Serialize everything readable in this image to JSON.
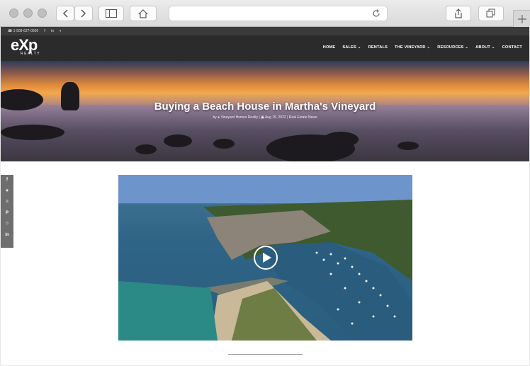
{
  "topbar": {
    "phone": "1-508-627-0506",
    "social_icons": [
      "facebook-icon",
      "linkedin-icon",
      "rss-icon"
    ],
    "social_glyphs": [
      "f",
      "in",
      "◐"
    ]
  },
  "logo": {
    "mark": "eXp",
    "tagline": "REALTY"
  },
  "nav": {
    "items": [
      {
        "label": "HOME"
      },
      {
        "label": "SALES",
        "caret": "⌄"
      },
      {
        "label": "RENTALS"
      },
      {
        "label": "THE VINEYARD",
        "caret": "⌄"
      },
      {
        "label": "RESOURCES",
        "caret": "⌄"
      },
      {
        "label": "ABOUT",
        "caret": "⌄"
      },
      {
        "label": "CONTACT"
      }
    ]
  },
  "post": {
    "title": "Buying a Beach House in Martha's Vineyard",
    "by": "by",
    "author": "Vineyard Homes Realty",
    "date": "Aug 15, 2022",
    "category": "Real Estate News"
  },
  "share_bar": {
    "icons": [
      "facebook-icon",
      "twitter-icon",
      "buffer-icon",
      "pinterest-icon",
      "reddit-icon",
      "linkedin-icon"
    ],
    "glyphs": [
      "f",
      "✦",
      "≡",
      "P",
      "☺",
      "in"
    ]
  },
  "colors": {
    "topbar": "#3b3b3b",
    "nav": "#2b2b2b",
    "share": "#6e6e6e"
  }
}
